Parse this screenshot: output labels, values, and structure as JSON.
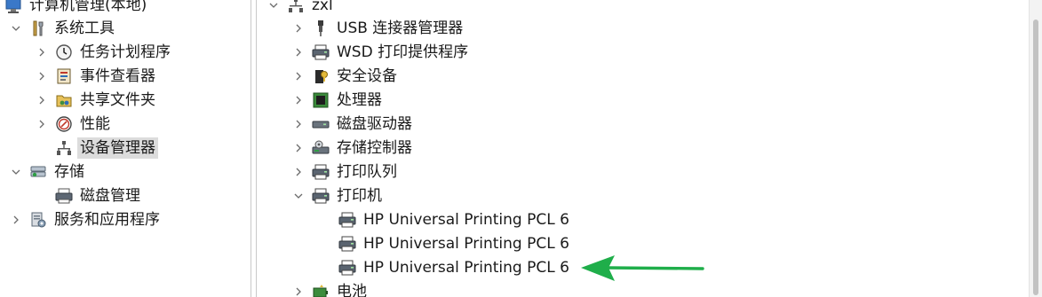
{
  "left_tree": {
    "root": "计算机管理(本地)",
    "system_tools": "系统工具",
    "task_scheduler": "任务计划程序",
    "event_viewer": "事件查看器",
    "shared_folders": "共享文件夹",
    "performance": "性能",
    "device_manager": "设备管理器",
    "storage": "存储",
    "disk_management": "磁盘管理",
    "services_apps": "服务和应用程序"
  },
  "device_tree": {
    "computer": "zxl",
    "usb_connector": "USB 连接器管理器",
    "wsd_print": "WSD 打印提供程序",
    "security_devices": "安全设备",
    "processors": "处理器",
    "disk_drives": "磁盘驱动器",
    "storage_controllers": "存储控制器",
    "print_queues": "打印队列",
    "printers": "打印机",
    "printer_1": "HP Universal Printing PCL 6",
    "printer_2": "HP Universal Printing PCL 6",
    "printer_3": "HP Universal Printing PCL 6",
    "batteries": "电池"
  },
  "colors": {
    "annotation_arrow": "#1fae4a",
    "selection": "#dcdcdc"
  }
}
